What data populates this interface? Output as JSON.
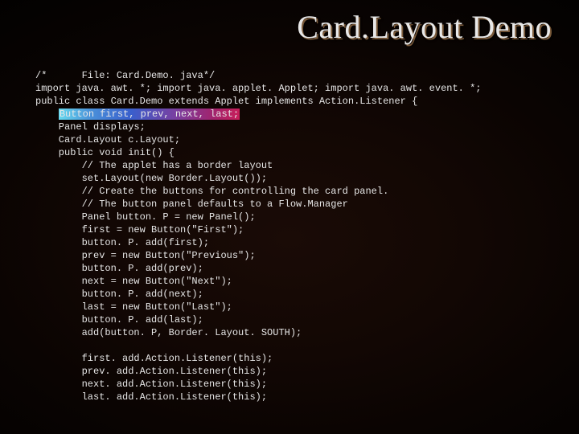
{
  "title": "Card.Layout Demo",
  "code": {
    "l0": "/*      File: Card.Demo. java*/",
    "l1": "import java. awt. *; import java. applet. Applet; import java. awt. event. *;",
    "l2": "public class Card.Demo extends Applet implements Action.Listener {",
    "l3": "Button first, prev, next, last;",
    "l4": "    Panel displays;",
    "l5": "    Card.Layout c.Layout;",
    "l6": "    public void init() {",
    "l7": "        // The applet has a border layout",
    "l8": "        set.Layout(new Border.Layout());",
    "l9": "        // Create the buttons for controlling the card panel.",
    "l10": "        // The button panel defaults to a Flow.Manager",
    "l11": "        Panel button. P = new Panel();",
    "l12": "        first = new Button(\"First\");",
    "l13": "        button. P. add(first);",
    "l14": "        prev = new Button(\"Previous\");",
    "l15": "        button. P. add(prev);",
    "l16": "        next = new Button(\"Next\");",
    "l17": "        button. P. add(next);",
    "l18": "        last = new Button(\"Last\");",
    "l19": "        button. P. add(last);",
    "l20": "        add(button. P, Border. Layout. SOUTH);",
    "blank": "",
    "l21": "        first. add.Action.Listener(this);",
    "l22": "        prev. add.Action.Listener(this);",
    "l23": "        next. add.Action.Listener(this);",
    "l24": "        last. add.Action.Listener(this);"
  }
}
